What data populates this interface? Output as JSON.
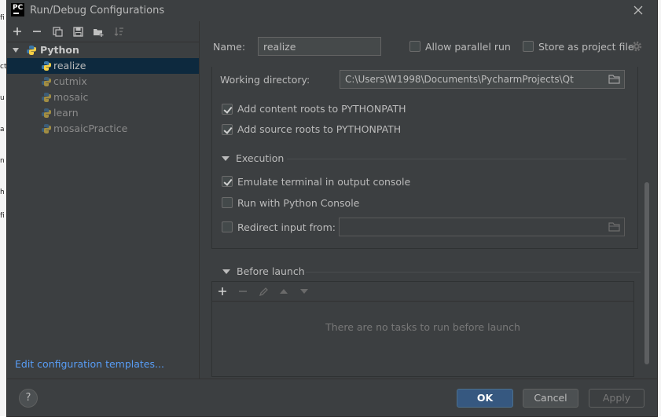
{
  "dialog": {
    "title": "Run/Debug Configurations",
    "app_icon_text": "PC"
  },
  "left": {
    "toolbar": [
      "add-icon",
      "remove-icon",
      "copy-icon",
      "save-icon",
      "folder-add-icon",
      "sort-icon"
    ],
    "tree": {
      "root": "Python",
      "items": [
        "realize",
        "cutmix",
        "mosaic",
        "learn",
        "mosaicPractice"
      ],
      "selected": "realize"
    },
    "edit_templates_link": "Edit configuration templates..."
  },
  "form": {
    "name_label": "Name:",
    "name_value": "realize",
    "allow_parallel_label": "Allow parallel run",
    "allow_parallel_checked": false,
    "store_project_label": "Store as project file",
    "store_project_checked": false,
    "working_dir_label": "Working directory:",
    "working_dir_value": "C:\\Users\\W1998\\Documents\\PycharmProjects\\Qt",
    "content_roots_label": "Add content roots to PYTHONPATH",
    "content_roots_checked": true,
    "source_roots_label": "Add source roots to PYTHONPATH",
    "source_roots_checked": true,
    "execution_header": "Execution",
    "emulate_terminal_label": "Emulate terminal in output console",
    "emulate_terminal_checked": true,
    "python_console_label": "Run with Python Console",
    "python_console_checked": false,
    "redirect_input_label": "Redirect input from:",
    "redirect_input_checked": false,
    "redirect_input_value": ""
  },
  "before_launch": {
    "header": "Before launch",
    "empty_message": "There are no tasks to run before launch"
  },
  "footer": {
    "help_label": "?",
    "ok_label": "OK",
    "cancel_label": "Cancel",
    "apply_label": "Apply"
  },
  "colors": {
    "background": "#3c3f41",
    "selection": "#0d293e",
    "link": "#589df6",
    "ok_button": "#365880",
    "python_blue": "#3b77a8",
    "python_yellow": "#f7d045"
  }
}
